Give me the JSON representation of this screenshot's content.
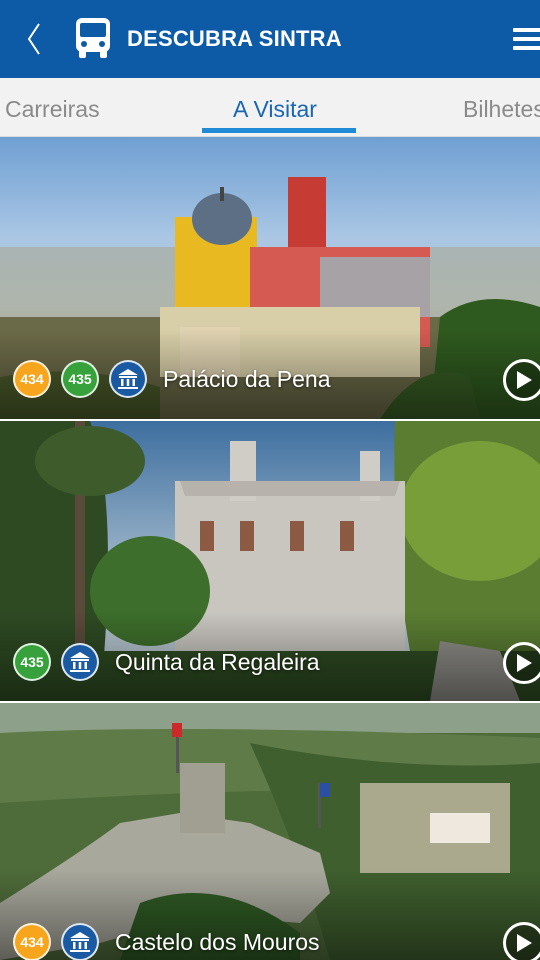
{
  "header": {
    "title": "DESCUBRA SINTRA",
    "bar_color": "#0d5aa7",
    "back_icon": "chevron-left-icon",
    "bus_icon": "bus-icon",
    "menu_icon": "hamburger-menu-icon"
  },
  "tabs": [
    {
      "label": "Carreiras",
      "active": false
    },
    {
      "label": "A Visitar",
      "active": true
    },
    {
      "label": "Bilhetes",
      "active": false
    }
  ],
  "places": [
    {
      "name": "Palácio da Pena",
      "routes": [
        "434",
        "435"
      ],
      "monument_icon": "monument-icon",
      "action_icon": "play-icon"
    },
    {
      "name": "Quinta da Regaleira",
      "routes": [
        "435"
      ],
      "monument_icon": "monument-icon",
      "action_icon": "play-icon"
    },
    {
      "name": "Castelo dos Mouros",
      "routes": [
        "434"
      ],
      "monument_icon": "monument-icon",
      "action_icon": "play-icon"
    }
  ],
  "colors": {
    "route_434": "#f7a51c",
    "route_435": "#37a23c",
    "monument": "#1a5aa3",
    "tab_active": "#1a66b3",
    "tab_indicator": "#1f8ad6"
  }
}
